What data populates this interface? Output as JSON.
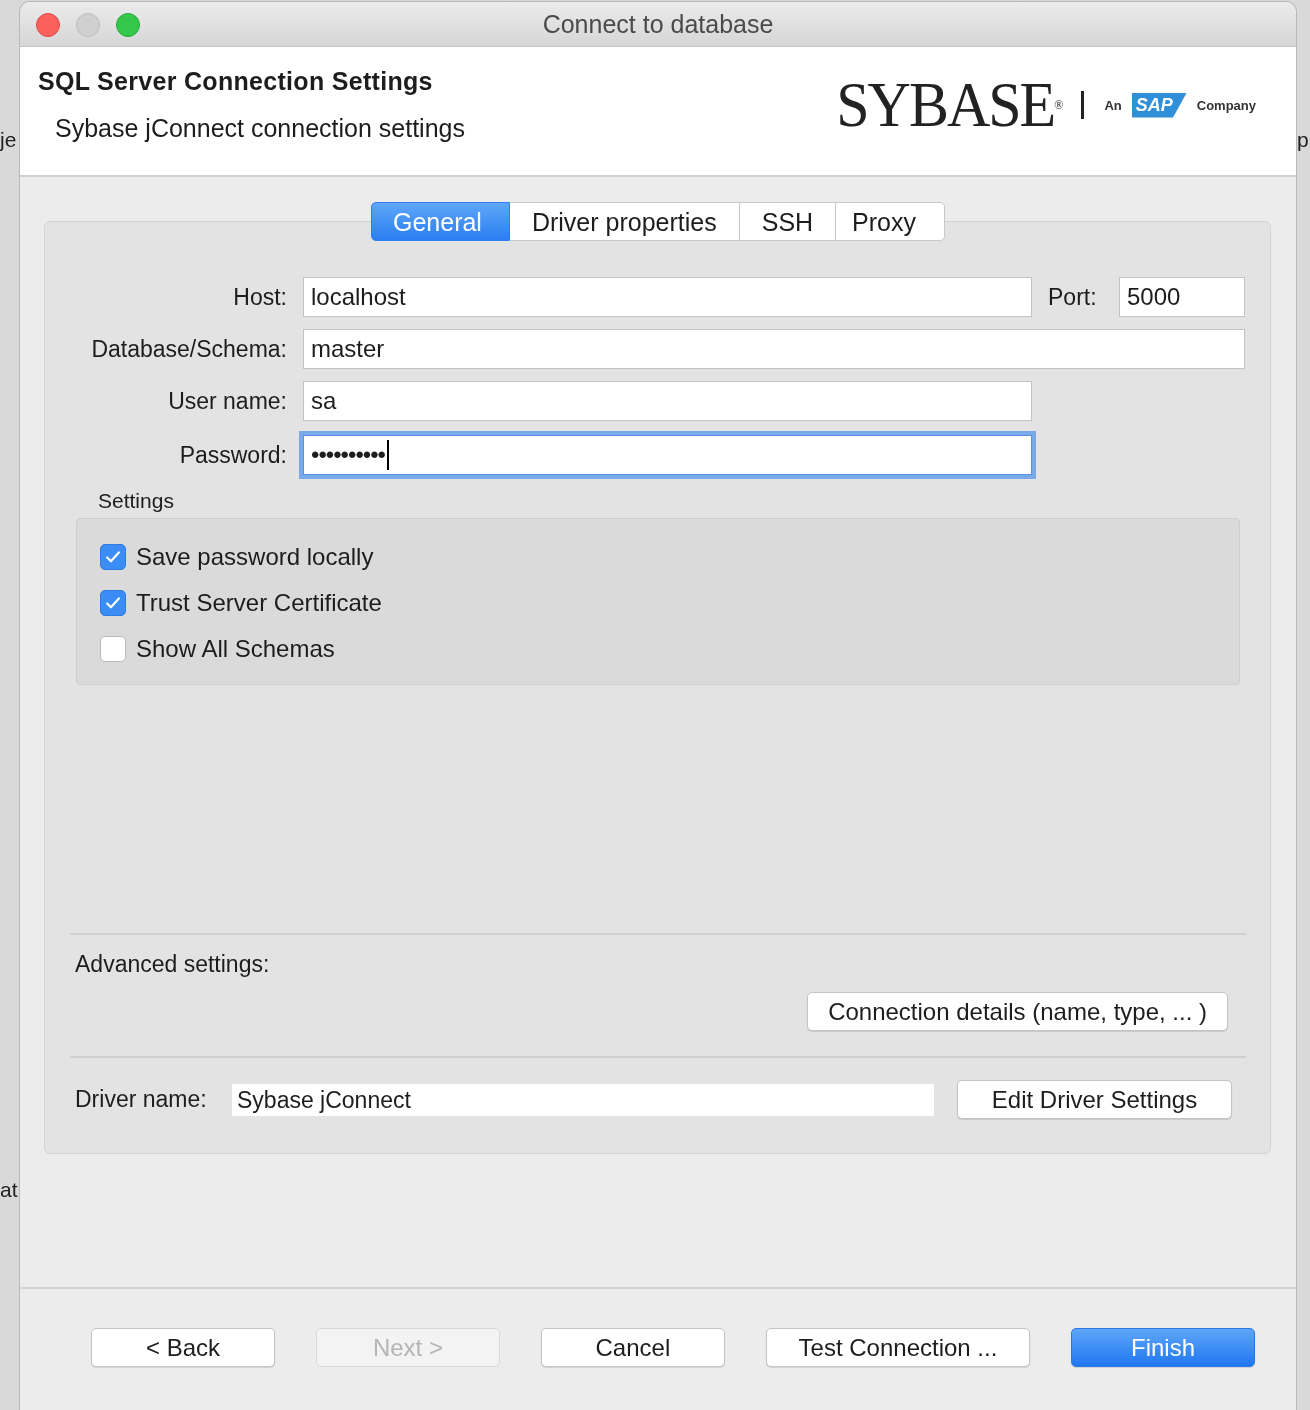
{
  "background_app": {
    "fragments": [
      {
        "text": "je"
      },
      {
        "text": "at"
      },
      {
        "text": "p"
      }
    ]
  },
  "window": {
    "title": "Connect to database"
  },
  "header": {
    "title": "SQL Server Connection Settings",
    "subtitle": "Sybase jConnect connection settings",
    "logo": {
      "brand": "SYBASE$^{®}$",
      "prefix": "An",
      "badge": "SAP",
      "suffix": "Company"
    }
  },
  "tabs": [
    {
      "label": "General",
      "selected": true
    },
    {
      "label": "Driver properties",
      "selected": false
    },
    {
      "label": "SSH",
      "selected": false
    },
    {
      "label": "Proxy",
      "selected": false
    }
  ],
  "fields": [
    {
      "kind": "short",
      "label": "Host:",
      "value": "localhost",
      "focused": false,
      "side": {
        "label": "Port:",
        "value": "5000"
      }
    },
    {
      "kind": "wide",
      "label": "Database/Schema:",
      "value": "master",
      "focused": false
    },
    {
      "kind": "short",
      "label": "User name:",
      "value": "sa",
      "focused": false
    },
    {
      "kind": "short",
      "label": "Password:",
      "value": "••••••••••",
      "focused": true
    }
  ],
  "settings": {
    "title": "Settings",
    "options": [
      {
        "label": "Save password locally",
        "checked": true
      },
      {
        "label": "Trust Server Certificate",
        "checked": true
      },
      {
        "label": "Show All Schemas",
        "checked": false
      }
    ]
  },
  "advanced": {
    "label": "Advanced settings:",
    "button": "Connection details (name, type, ... )"
  },
  "driver": {
    "label": "Driver name:",
    "value": "Sybase jConnect",
    "button": "Edit Driver Settings"
  },
  "buttons": [
    {
      "label": "< Back",
      "disabled": false,
      "default": false
    },
    {
      "label": "Next >",
      "disabled": true,
      "default": false
    },
    {
      "label": "Cancel",
      "disabled": false,
      "default": false
    },
    {
      "label": "Test Connection ...",
      "disabled": false,
      "default": false
    },
    {
      "label": "Finish",
      "disabled": false,
      "default": true
    }
  ]
}
